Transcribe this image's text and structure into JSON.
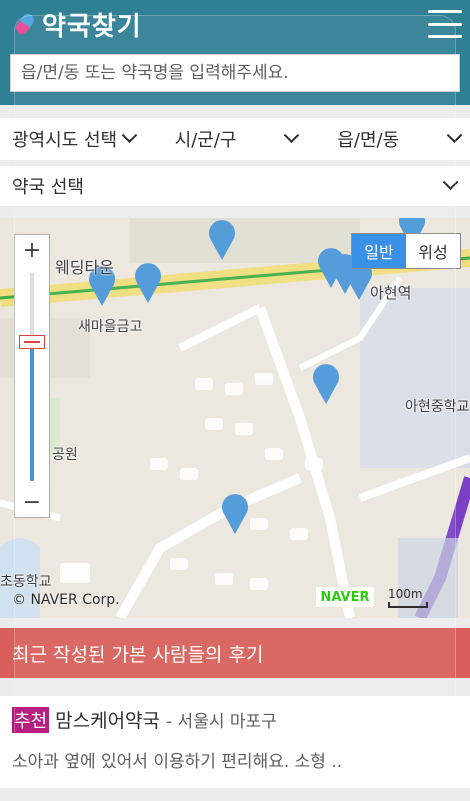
{
  "header": {
    "logo_text": "약국찾기",
    "search_placeholder": "읍/면/동 또는 약국명을 입력해주세요."
  },
  "filters": {
    "province": "광역시도 선택",
    "city": "시/군/구",
    "town": "읍/면/동",
    "pharmacy": "약국 선택"
  },
  "map": {
    "zoom_in": "+",
    "zoom_out": "−",
    "type_normal": "일반",
    "type_satellite": "위성",
    "labels": {
      "wedding_town": "웨딩타운",
      "saemaeul": "새마을금고",
      "ahyeon_station": "아현역",
      "ahyeon_middle": "아현중학교",
      "park": "공원",
      "school": "초동학교"
    },
    "copyright": "© NAVER Corp.",
    "naver": "NAVER",
    "scale": "100m",
    "accent": "#2d8ae6",
    "pin_color": "#4a96d8"
  },
  "reviews": {
    "title": "최근 작성된 가본 사람들의 후기",
    "items": [
      {
        "badge": "추천",
        "name": "맘스케어약국",
        "region": "- 서울시 마포구",
        "text": "소아과 옆에 있어서 이용하기 편리해요. 소형 .."
      }
    ]
  }
}
